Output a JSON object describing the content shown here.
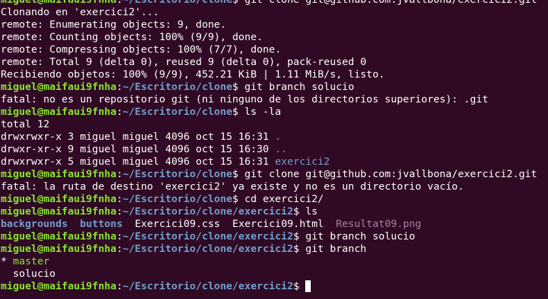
{
  "terminal": {
    "prompt_user": "miguel@maifaui9fnha",
    "lines": [
      {
        "type": "prompt",
        "path": "~/Escritorio/clone",
        "cmd": " git clone git@github.com:jvallbona/exercici2.git"
      },
      {
        "type": "text",
        "text": "Clonando en 'exercici2'..."
      },
      {
        "type": "text",
        "text": "remote: Enumerating objects: 9, done."
      },
      {
        "type": "text",
        "text": "remote: Counting objects: 100% (9/9), done."
      },
      {
        "type": "text",
        "text": "remote: Compressing objects: 100% (7/7), done."
      },
      {
        "type": "text",
        "text": "remote: Total 9 (delta 0), reused 9 (delta 0), pack-reused 0"
      },
      {
        "type": "text",
        "text": "Recibiendo objetos: 100% (9/9), 452.21 KiB | 1.11 MiB/s, listo."
      },
      {
        "type": "prompt",
        "path": "~/Escritorio/clone",
        "cmd": " git branch solucio"
      },
      {
        "type": "text",
        "text": "fatal: no es un repositorio git (ni ninguno de los directorios superiores): .git"
      },
      {
        "type": "prompt",
        "path": "~/Escritorio/clone",
        "cmd": " ls -la"
      },
      {
        "type": "text",
        "text": "total 12"
      },
      {
        "type": "lsla",
        "text": "drwxrwxr-x 3 miguel miguel 4096 oct 15 16:31 ",
        "name": "."
      },
      {
        "type": "lsla",
        "text": "drwxr-xr-x 9 miguel miguel 4096 oct 15 16:30 ",
        "name": ".."
      },
      {
        "type": "lsla",
        "text": "drwxrwxr-x 5 miguel miguel 4096 oct 15 16:31 ",
        "name": "exercici2"
      },
      {
        "type": "prompt",
        "path": "~/Escritorio/clone",
        "cmd": " git clone git@github.com:jvallbona/exercici2.git"
      },
      {
        "type": "text",
        "text": "fatal: la ruta de destino 'exercici2' ya existe y no es un directorio vacío."
      },
      {
        "type": "prompt",
        "path": "~/Escritorio/clone",
        "cmd": " cd exercici2/"
      },
      {
        "type": "prompt",
        "path": "~/Escritorio/clone/exercici2",
        "cmd": " ls"
      },
      {
        "type": "ls",
        "items": [
          {
            "name": "backgrounds",
            "kind": "dir",
            "sep": "  "
          },
          {
            "name": "buttons",
            "kind": "dir",
            "sep": "  "
          },
          {
            "name": "Exercici09.css",
            "kind": "file",
            "sep": "  "
          },
          {
            "name": "Exercici09.html",
            "kind": "file",
            "sep": "  "
          },
          {
            "name": "Resultat09.png",
            "kind": "img",
            "sep": ""
          }
        ]
      },
      {
        "type": "prompt",
        "path": "~/Escritorio/clone/exercici2",
        "cmd": " git branch solucio"
      },
      {
        "type": "prompt",
        "path": "~/Escritorio/clone/exercici2",
        "cmd": " git branch"
      },
      {
        "type": "branch",
        "marker": "* ",
        "name": "master",
        "current": true
      },
      {
        "type": "branch",
        "marker": "  ",
        "name": "solucio",
        "current": false
      },
      {
        "type": "prompt",
        "path": "~/Escritorio/clone/exercici2",
        "cmd": " ",
        "cursor": true
      }
    ]
  },
  "colors": {
    "background": "#300a24",
    "foreground": "#ffffff",
    "user": "#8ae234",
    "path": "#729fcf",
    "directory": "#729fcf",
    "image_file": "#ad7fa8",
    "current_branch": "#8ae234"
  },
  "icons": {
    "cursor": "block-cursor"
  }
}
